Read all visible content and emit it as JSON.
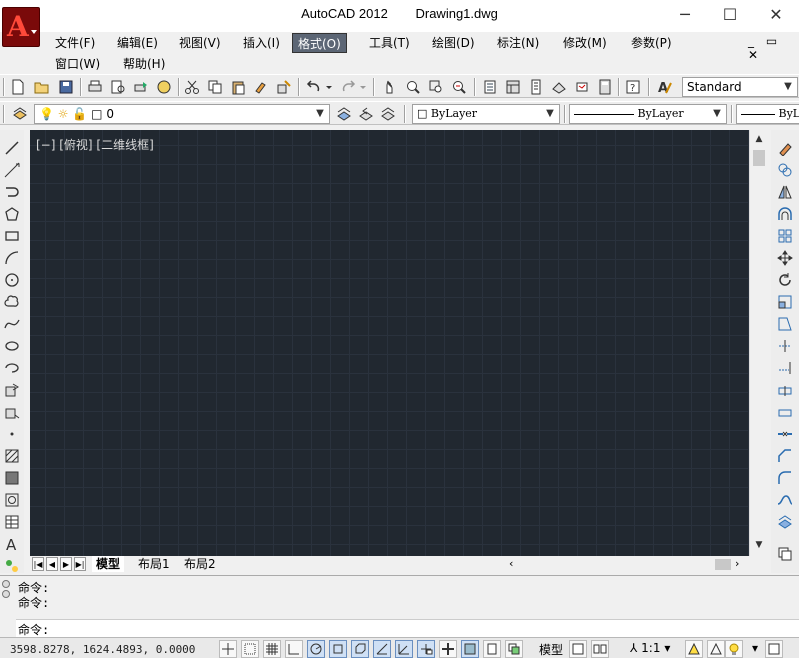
{
  "window": {
    "app_title": "AutoCAD 2012",
    "doc_title": "Drawing1.dwg",
    "minimize_glyph": "─",
    "maximize_glyph": "☐",
    "close_glyph": "✕",
    "logo_letter": "A"
  },
  "menus": [
    {
      "label": "文件(F)"
    },
    {
      "label": "编辑(E)"
    },
    {
      "label": "视图(V)"
    },
    {
      "label": "插入(I)"
    },
    {
      "label": "格式(O)",
      "active": true
    },
    {
      "label": "工具(T)"
    },
    {
      "label": "绘图(D)"
    },
    {
      "label": "标注(N)"
    },
    {
      "label": "修改(M)"
    },
    {
      "label": "参数(P)"
    },
    {
      "label": "窗口(W)"
    },
    {
      "label": "帮助(H)"
    }
  ],
  "mdi_controls": "_ ▭ ✕",
  "toolbar": {
    "text_style": "Standard",
    "layer_name": "0",
    "color": "ByLayer",
    "linetype": "ByLayer",
    "lineweight": "ByLa"
  },
  "viewport": {
    "label": "[−] [俯视] [二维线框]",
    "background": "#212830"
  },
  "layout_tabs": [
    {
      "label": "模型",
      "active": true
    },
    {
      "label": "布局1"
    },
    {
      "label": "布局2"
    }
  ],
  "command": {
    "history": [
      "命令:",
      "命令:"
    ],
    "prompt": "命令:"
  },
  "status": {
    "coords": "3598.8278,  1624.4893,  0.0000",
    "model_label": "模型",
    "scale": "1:1"
  }
}
